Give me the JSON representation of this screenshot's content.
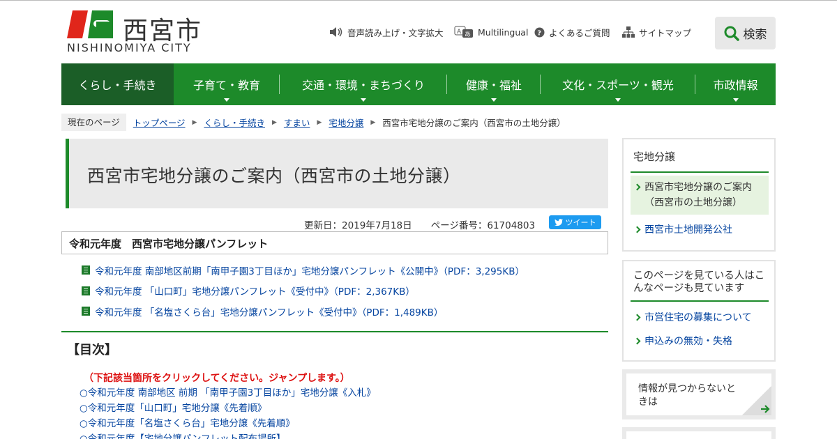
{
  "header": {
    "logo_kanji": "西宮市",
    "logo_en": "NISHINOMIYA CITY",
    "utility": [
      {
        "label": "音声読み上げ・文字拡大",
        "icon": "speaker-icon"
      },
      {
        "label": "Multilingual",
        "icon": "translate-icon"
      },
      {
        "label": "よくあるご質問",
        "icon": "question-icon"
      },
      {
        "label": "サイトマップ",
        "icon": "sitemap-icon"
      }
    ],
    "search_label": "検索"
  },
  "nav": [
    {
      "label": "くらし・手続き",
      "active": true
    },
    {
      "label": "子育て・教育"
    },
    {
      "label": "交通・環境・まちづくり"
    },
    {
      "label": "健康・福祉"
    },
    {
      "label": "文化・スポーツ・観光"
    },
    {
      "label": "市政情報"
    }
  ],
  "breadcrumb": {
    "here_label": "現在のページ",
    "links": [
      "トップページ",
      "くらし・手続き",
      "すまい",
      "宅地分譲"
    ],
    "current": "西宮市宅地分譲のご案内（西宮市の土地分譲）"
  },
  "page": {
    "title": "西宮市宅地分譲のご案内（西宮市の土地分譲）",
    "updated": "更新日：2019年7月18日　　ページ番号：61704803",
    "tweet_label": "ツイート",
    "pamphlet_heading": "令和元年度　西宮市宅地分譲パンフレット",
    "pdf_links": [
      "令和元年度 南部地区前期「南甲子園3丁目ほか」宅地分譲パンフレット《公開中》（PDF：3,295KB）",
      "令和元年度 「山口町」宅地分譲パンフレット《受付中》（PDF：2,367KB）",
      "令和元年度 「名塩さくら台」宅地分譲パンフレット《受付中》（PDF：1,489KB）"
    ],
    "toc_title": "【目次】",
    "toc_note": "（下記該当箇所をクリックしてください。ジャンプします。）",
    "toc_items": [
      "○令和元年度 南部地区 前期 「南甲子園3丁目ほか」宅地分譲《入札》",
      "○令和元年度「山口町」宅地分譲《先着順》",
      "○令和元年度「名塩さくら台」宅地分譲《先着順》",
      "○令和元年度【宅地分譲パンフレット配布場所】"
    ]
  },
  "sidebar": {
    "section_title": "宅地分譲",
    "section_items": [
      {
        "label": "西宮市宅地分譲のご案内（西宮市の土地分譲）",
        "current": true
      },
      {
        "label": "西宮市土地開発公社"
      }
    ],
    "related_title": "このページを見ている人はこんなページも見ています",
    "related_items": [
      "市営住宅の募集について",
      "申込みの無効・失格"
    ],
    "help_text": "情報が見つからないときは"
  },
  "colors": {
    "brand_green": "#1d8a2a",
    "nav_active": "#1b5e27",
    "logo_red": "#e0261b",
    "link": "#0645a0"
  }
}
